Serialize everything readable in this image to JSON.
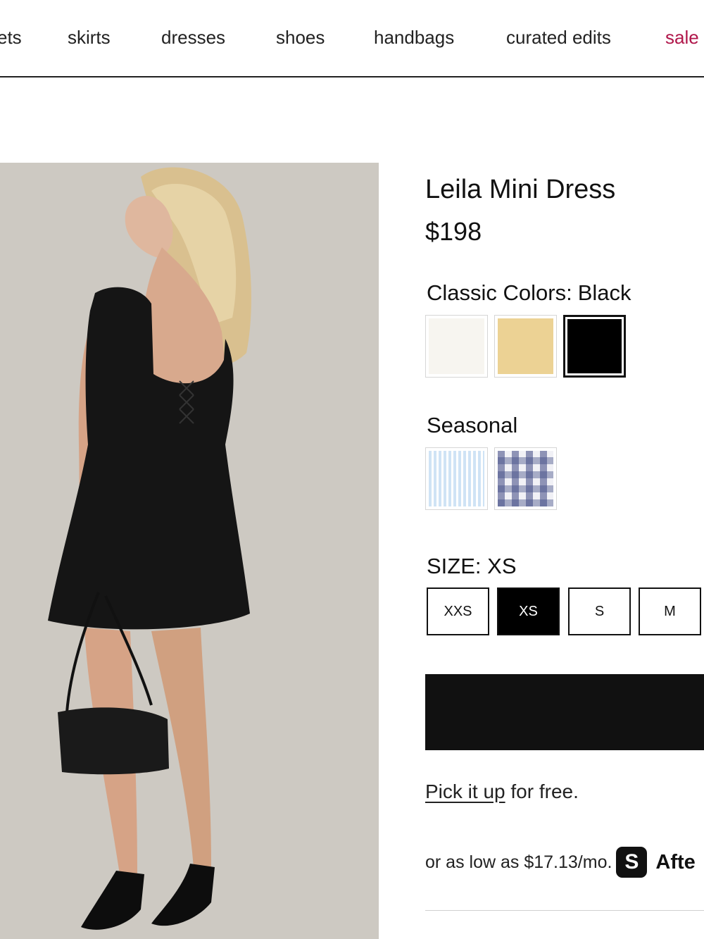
{
  "nav": {
    "items": [
      {
        "label": "ets"
      },
      {
        "label": "skirts"
      },
      {
        "label": "dresses"
      },
      {
        "label": "shoes"
      },
      {
        "label": "handbags"
      },
      {
        "label": "curated edits"
      },
      {
        "label": "sale"
      }
    ],
    "sale_color": "#b0164a"
  },
  "product": {
    "name": "Leila Mini Dress",
    "price": "$198",
    "image_alt": "model wearing black mini dress with black shoulder bag"
  },
  "colors": {
    "classic_label": "Classic Colors:",
    "selected_value": "Black",
    "classic": [
      {
        "name": "ivory",
        "hex": "#f7f5f0"
      },
      {
        "name": "yellow",
        "hex": "#ecd294"
      },
      {
        "name": "black",
        "hex": "#000000",
        "selected": true
      }
    ],
    "seasonal_label": "Seasonal",
    "seasonal": [
      {
        "name": "blue-stripe",
        "hex": "#d8e8f6"
      },
      {
        "name": "navy-plaid",
        "hex": "#9da3c4"
      }
    ]
  },
  "size": {
    "label": "SIZE:",
    "selected_value": "XS",
    "options": [
      "XXS",
      "XS",
      "S",
      "M"
    ]
  },
  "pickup": {
    "link": "Pick it up",
    "rest": "for free."
  },
  "afterpay": {
    "text": "or as low as $17.13/mo.",
    "icon_glyph": "S",
    "brand": "Afte"
  }
}
